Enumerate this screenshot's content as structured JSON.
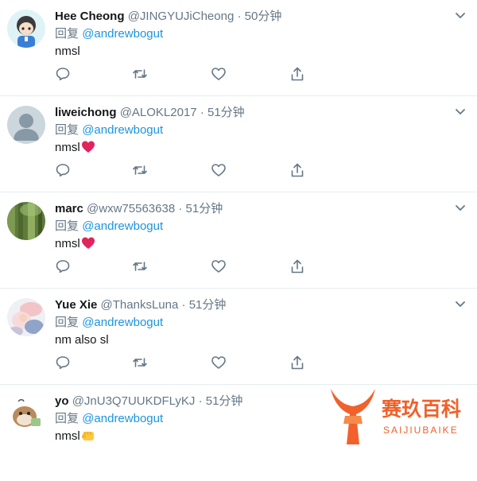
{
  "tweets": [
    {
      "name": "Hee Cheong",
      "handle": "@JINGYUJiCheong",
      "sep": "·",
      "time": "50分钟",
      "reply_prefix": "回复",
      "mention": "@andrewbogut",
      "text": "nmsl",
      "emoji": ""
    },
    {
      "name": "liweichong",
      "handle": "@ALOKL2017",
      "sep": "·",
      "time": "51分钟",
      "reply_prefix": "回复",
      "mention": "@andrewbogut",
      "text": "nmsl",
      "emoji": "red-heart"
    },
    {
      "name": "marc",
      "handle": "@wxw75563638",
      "sep": "·",
      "time": "51分钟",
      "reply_prefix": "回复",
      "mention": "@andrewbogut",
      "text": "nmsl",
      "emoji": "red-heart"
    },
    {
      "name": "Yue Xie",
      "handle": "@ThanksLuna",
      "sep": "·",
      "time": "51分钟",
      "reply_prefix": "回复",
      "mention": "@andrewbogut",
      "text": "nm also sl",
      "emoji": ""
    },
    {
      "name": "yo",
      "handle": "@JnU3Q7UUKDFLyKJ",
      "sep": "·",
      "time": "51分钟",
      "reply_prefix": "回复",
      "mention": "@andrewbogut",
      "text": "nmsl",
      "emoji": "fist"
    }
  ],
  "icons": {
    "caret": "chevron-down-icon",
    "reply": "reply-icon",
    "retweet": "retweet-icon",
    "like": "heart-icon",
    "share": "share-icon"
  },
  "colors": {
    "text": "#14171a",
    "muted": "#657786",
    "link": "#1b95e0",
    "icon": "#657786",
    "heart": "#e0245e",
    "watermark_orange": "#f0612b"
  },
  "watermark": {
    "title": "赛玖百科",
    "subtitle": "SAIJIUBAIKE"
  }
}
